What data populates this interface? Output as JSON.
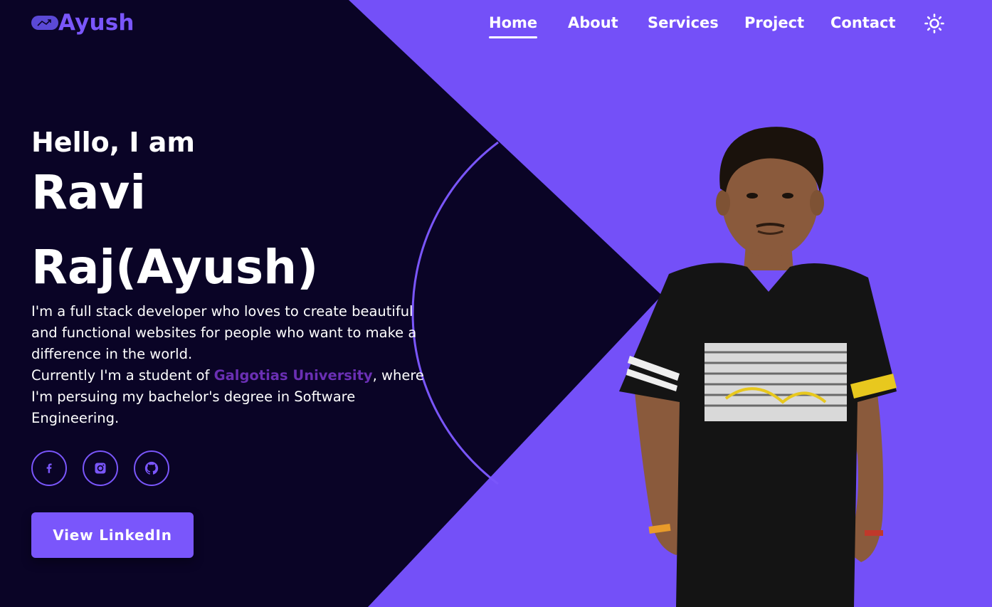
{
  "colors": {
    "background": "#0a0426",
    "accent": "#7a56fb",
    "highlight": "#6a2fb4",
    "text": "#ffffff"
  },
  "header": {
    "logo_text": "Ayush",
    "logo_icon": "rocket-badge-icon",
    "nav": [
      {
        "label": "Home",
        "active": true
      },
      {
        "label": "About",
        "active": false
      },
      {
        "label": "Services",
        "active": false
      },
      {
        "label": "Project",
        "active": false
      },
      {
        "label": "Contact",
        "active": false
      }
    ],
    "theme_icon": "sun-icon"
  },
  "hero": {
    "greeting": "Hello, I am",
    "name": "Ravi Raj(Ayush)",
    "bio_line1": "I'm a full stack developer who loves to create beautiful and functional websites for people who want to make a difference in the world.",
    "bio_prefix": "Currently I'm a student of ",
    "university": "Galgotias University",
    "bio_suffix": ", where I'm persuing my bachelor's degree in Software Engineering.",
    "socials": [
      {
        "icon": "facebook-icon"
      },
      {
        "icon": "instagram-icon"
      },
      {
        "icon": "github-icon"
      }
    ],
    "cta_label": "View LinkedIn"
  }
}
